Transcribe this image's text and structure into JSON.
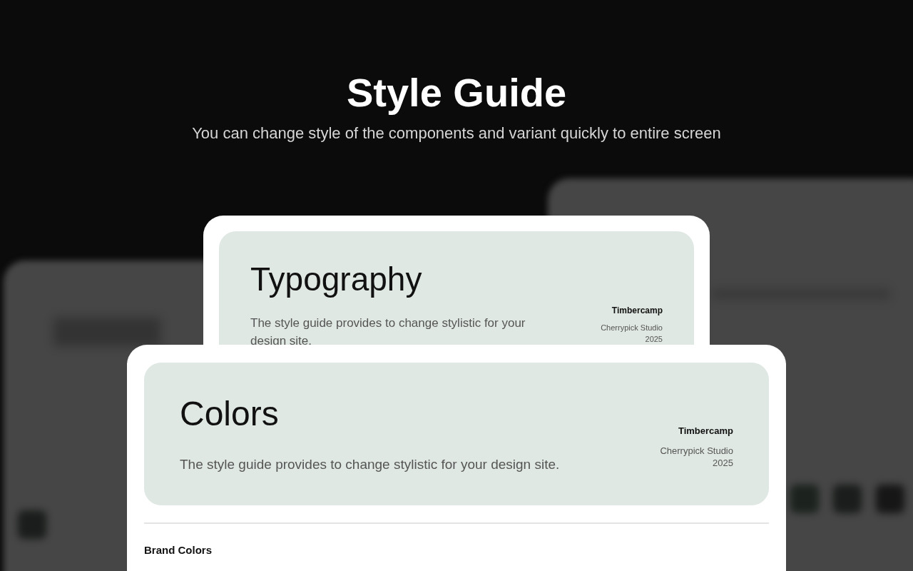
{
  "header": {
    "title": "Style Guide",
    "subtitle": "You can change style of the components and variant quickly to entire screen"
  },
  "cards": [
    {
      "title": "Typography",
      "description": "The style guide provides to change stylistic for your design site.",
      "brand": "Timbercamp",
      "studio": "Cherrypick Studio",
      "year": "2025"
    },
    {
      "title": "Colors",
      "description": "The style guide provides to change stylistic for your design site.",
      "brand": "Timbercamp",
      "studio": "Cherrypick Studio",
      "year": "2025",
      "section": "Brand Colors"
    }
  ]
}
